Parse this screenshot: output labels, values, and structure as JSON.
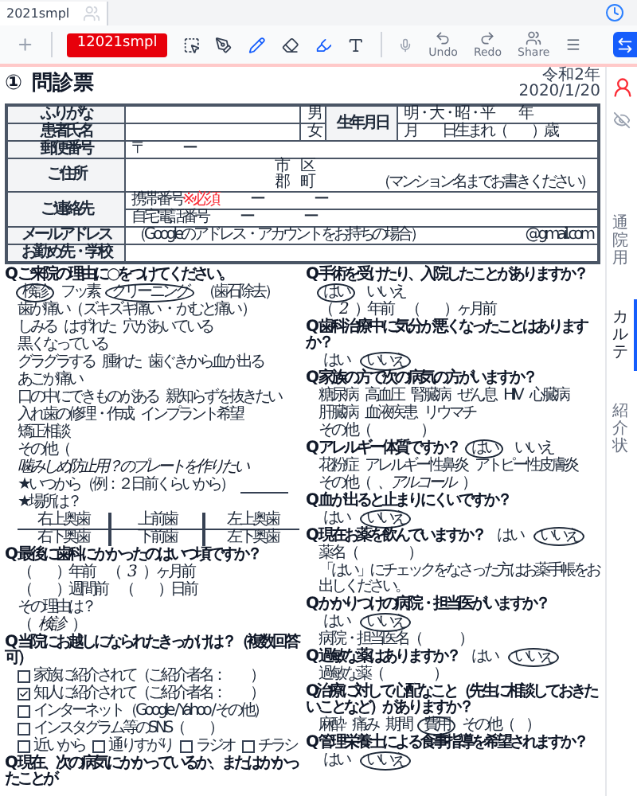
{
  "tabs": [
    {
      "label": "2021smpl",
      "selected": true
    }
  ],
  "toolbar": {
    "record": "12021smpl",
    "actions": [
      {
        "label": "Undo",
        "disabled": true
      },
      {
        "label": "Redo",
        "disabled": true
      },
      {
        "label": "Share",
        "disabled": true
      }
    ]
  },
  "side_tabs": [
    {
      "label": "通院用",
      "selected": false
    },
    {
      "label": "カルテ",
      "selected": true
    },
    {
      "label": "紹介状",
      "selected": false
    }
  ],
  "form": {
    "number": "①",
    "title": "問診票",
    "era": "令和2年",
    "date": "2020/1/20",
    "table": {
      "furigana": "ふりがな",
      "male": "男",
      "birth_label": "生年月日",
      "birth_era": "明・大・昭・平　　年",
      "name": "患者氏名",
      "female": "女",
      "birth_line": "月　　日生まれ（　　）歳",
      "postal_label": "郵便番号",
      "postal": "〒　　　ー",
      "address_label": "ご住所",
      "address_lines": [
        "市　区",
        "郡　町"
      ],
      "address_note": "（マンション名までお書きください）",
      "contact_label": "ご連絡先",
      "mobile_label": "携帯番号",
      "mobile_required": "※必須",
      "mobile_value": "ー　　　　ー",
      "home_label": "自宅電話番号",
      "home_value": "ー　　　　ー",
      "email_label": "メールアドレス",
      "email_note": "（Googleのアドレス・アカウントをお持ちの場合）",
      "email_domain": "@gmail.com",
      "work_label": "お勤め先・学校"
    },
    "columns": [
      [
        {
          "q": "Q ご来院の理由に○をつけてください。",
          "lines": [
            [
              {
                "kind": "option",
                "text": "検診",
                "selected": true
              },
              {
                "kind": "text",
                "text": "フッ素"
              },
              {
                "kind": "option",
                "text": "クリーニング",
                "selected": true
              },
              {
                "kind": "text",
                "text": "（歯石除去）"
              }
            ],
            [
              {
                "kind": "text",
                "text": "歯が痛い（ ズキズキ痛い ・ かむと痛い ）"
              }
            ],
            [
              {
                "kind": "text",
                "text": "しみる"
              },
              {
                "kind": "text",
                "text": "はずれた"
              },
              {
                "kind": "text",
                "text": "穴があいている"
              },
              {
                "kind": "text",
                "text": "黒くなっている"
              }
            ],
            [
              {
                "kind": "text",
                "text": "グラグラする"
              },
              {
                "kind": "text",
                "text": "腫れた"
              },
              {
                "kind": "text",
                "text": "歯ぐきから血が出る"
              },
              {
                "kind": "text",
                "text": "あごが痛い"
              }
            ],
            [
              {
                "kind": "text",
                "text": "口の中にできものがある"
              },
              {
                "kind": "text",
                "text": "親知らずを抜きたい"
              }
            ],
            [
              {
                "kind": "text",
                "text": "入れ歯の修理・作成"
              },
              {
                "kind": "text",
                "text": "インプラント希望"
              },
              {
                "kind": "text",
                "text": "矯正相談"
              }
            ],
            [
              {
                "kind": "text",
                "text": "その他（"
              },
              {
                "kind": "hand",
                "text": "噛みしめ防止用？のプレートを作りたい"
              }
            ],
            [
              {
                "kind": "text",
                "text": "★いつから（例：２日前くらいから）"
              },
              {
                "kind": "blank"
              }
            ],
            [
              {
                "kind": "text",
                "text": "★場所は？"
              }
            ],
            [
              {
                "kind": "teeth",
                "rows": [
                  [
                    "右上奥歯",
                    "上前歯",
                    "左上奥歯"
                  ],
                  [
                    "右下奥歯",
                    "下前歯",
                    "左下奥歯"
                  ]
                ]
              }
            ]
          ]
        },
        {
          "q": "Q 最後に歯科にかかったのはいつ頃ですか？",
          "lines": [
            [
              {
                "kind": "text",
                "text": "（　　）年前　（"
              },
              {
                "kind": "hand",
                "text": "3"
              },
              {
                "kind": "text",
                "text": "）ヶ月前"
              }
            ],
            [
              {
                "kind": "text",
                "text": "（　　）週間前　（　　）日前"
              }
            ],
            [
              {
                "kind": "text",
                "text": "その理由は？"
              }
            ],
            [
              {
                "kind": "text",
                "text": "（"
              },
              {
                "kind": "hand",
                "text": "検診"
              },
              {
                "kind": "text",
                "text": "）"
              }
            ]
          ]
        },
        {
          "q": "Q 当院にお越しになられたきっかけは？（複数回答可）",
          "lines": [
            [
              {
                "kind": "check",
                "text": "家族に紹介されて（ご紹介者名：　　）",
                "checked": false
              }
            ],
            [
              {
                "kind": "check",
                "text": "知人に紹介されて（ご紹介者名：　　）",
                "checked": true
              }
            ],
            [
              {
                "kind": "check",
                "text": "インターネット（Google / Yahoo / その他）",
                "checked": false
              }
            ],
            [
              {
                "kind": "check",
                "text": "インスタグラム等のSNS（　　）",
                "checked": false
              }
            ],
            [
              {
                "kind": "check",
                "text": "近いから",
                "checked": false
              },
              {
                "kind": "check",
                "text": "通りすがり",
                "checked": false
              },
              {
                "kind": "check",
                "text": "ラジオ",
                "checked": false
              },
              {
                "kind": "check",
                "text": "チラシ",
                "checked": false
              }
            ]
          ]
        },
        {
          "q": "Q 現在、次の病気にかかっているか、またはかかったことが"
        }
      ],
      [
        {
          "q": "Q 手術を受けたり、入院したことがありますか？",
          "lines": [
            [
              {
                "kind": "option",
                "text": "はい",
                "selected": true
              },
              {
                "kind": "option",
                "text": "いいえ",
                "selected": false
              }
            ],
            [
              {
                "kind": "text",
                "text": "（"
              },
              {
                "kind": "hand",
                "text": "2"
              },
              {
                "kind": "text",
                "text": "）年前　（　　）ヶ月前"
              }
            ]
          ]
        },
        {
          "q": "Q 歯科治療中に気分が悪くなったことはありますか？",
          "lines": [
            [
              {
                "kind": "option",
                "text": "はい",
                "selected": false
              },
              {
                "kind": "option",
                "text": "いいえ",
                "selected": true
              }
            ]
          ]
        },
        {
          "q": "Q 家族の方で次の病気の方がいますか？",
          "lines": [
            [
              {
                "kind": "text",
                "text": "糖尿病"
              },
              {
                "kind": "text",
                "text": "高血圧"
              },
              {
                "kind": "text",
                "text": "腎臓病"
              },
              {
                "kind": "text",
                "text": "ぜん息"
              },
              {
                "kind": "text",
                "text": "HIV"
              },
              {
                "kind": "text",
                "text": "心臓病"
              }
            ],
            [
              {
                "kind": "text",
                "text": "肝臓病"
              },
              {
                "kind": "text",
                "text": "血液疾患"
              },
              {
                "kind": "text",
                "text": "リウマチ"
              }
            ],
            [
              {
                "kind": "text",
                "text": "その他（　　　　）"
              }
            ]
          ]
        },
        {
          "q": "Q アレルギー体質ですか？",
          "answers": [
            {
              "kind": "option",
              "text": "はい",
              "selected": true
            },
            {
              "kind": "option",
              "text": "いいえ",
              "selected": false
            }
          ],
          "lines": [
            [
              {
                "kind": "text",
                "text": "花粉症"
              },
              {
                "kind": "text",
                "text": "アレルギー性鼻炎"
              },
              {
                "kind": "text",
                "text": "アトピー性皮膚炎"
              }
            ],
            [
              {
                "kind": "text",
                "text": "その他（"
              },
              {
                "kind": "hand",
                "text": "、アルコール"
              },
              {
                "kind": "text",
                "text": "）"
              }
            ]
          ]
        },
        {
          "q": "Q 血が出ると止まりにくいですか？",
          "lines": [
            [
              {
                "kind": "option",
                "text": "はい",
                "selected": false
              },
              {
                "kind": "option",
                "text": "いいえ",
                "selected": true
              }
            ]
          ]
        },
        {
          "q": "Q 現在お薬を飲んでいますか？",
          "answers": [
            {
              "kind": "option",
              "text": "はい",
              "selected": false
            },
            {
              "kind": "option",
              "text": "いいえ",
              "selected": true
            }
          ],
          "lines": [
            [
              {
                "kind": "text",
                "text": "薬名（　　　　）"
              }
            ],
            [
              {
                "kind": "note",
                "text": "「はい」にチェックをなさった方はお薬手帳をお出しください。"
              }
            ]
          ]
        },
        {
          "q": "Q かかりつけの病院・担当医がいますか？",
          "lines": [
            [
              {
                "kind": "option",
                "text": "はい",
                "selected": false
              },
              {
                "kind": "option",
                "text": "いいえ",
                "selected": true
              }
            ],
            [
              {
                "kind": "text",
                "text": "病院・担当医名（　　　）"
              }
            ]
          ]
        },
        {
          "q": "Q 過敏な薬はありますか？",
          "answers": [
            {
              "kind": "option",
              "text": "はい",
              "selected": false
            },
            {
              "kind": "option",
              "text": "いいえ",
              "selected": true
            }
          ],
          "lines": [
            [
              {
                "kind": "text",
                "text": "過敏な薬（　　　　）"
              }
            ]
          ]
        },
        {
          "q": "Q治療に対して心配なこと（先生に相談しておきたいことなど）がありますか？",
          "lines": [
            [
              {
                "kind": "text",
                "text": "麻酔"
              },
              {
                "kind": "text",
                "text": "痛み"
              },
              {
                "kind": "text",
                "text": "期間"
              },
              {
                "kind": "option",
                "text": "費用",
                "selected": true
              },
              {
                "kind": "text",
                "text": "その他（　）"
              }
            ]
          ]
        },
        {
          "q": "Q 管理栄養士による食事指導を希望されますか？",
          "lines": [
            [
              {
                "kind": "option",
                "text": "はい",
                "selected": false
              },
              {
                "kind": "option",
                "text": "いいえ",
                "selected": true
              }
            ]
          ]
        }
      ]
    ]
  }
}
